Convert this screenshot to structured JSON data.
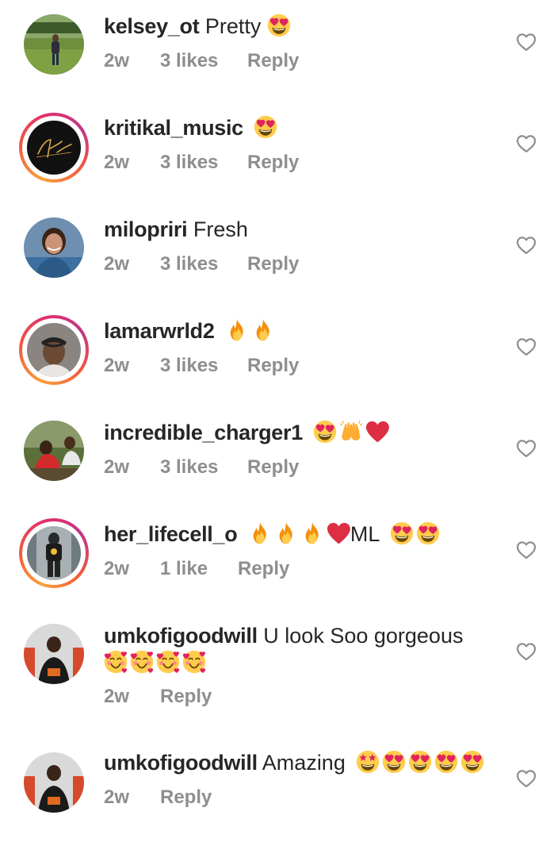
{
  "comments": [
    {
      "username": "kelsey_ot",
      "text": "Pretty",
      "emojis": [
        "heart-eyes"
      ],
      "time": "2w",
      "likes": "3 likes",
      "reply": "Reply",
      "story_ring": false
    },
    {
      "username": "kritikal_music",
      "text": "",
      "emojis": [
        "heart-eyes"
      ],
      "time": "2w",
      "likes": "3 likes",
      "reply": "Reply",
      "story_ring": true,
      "avatar_text": "Kritikal"
    },
    {
      "username": "milopriri",
      "text": "Fresh",
      "emojis": [],
      "time": "2w",
      "likes": "3 likes",
      "reply": "Reply",
      "story_ring": false
    },
    {
      "username": "lamarwrld2",
      "text": "",
      "emojis": [
        "fire",
        "fire"
      ],
      "time": "2w",
      "likes": "3 likes",
      "reply": "Reply",
      "story_ring": true
    },
    {
      "username": "incredible_charger1",
      "text": "",
      "emojis": [
        "heart-eyes",
        "raising-hands",
        "red-heart"
      ],
      "time": "2w",
      "likes": "3 likes",
      "reply": "Reply",
      "story_ring": false
    },
    {
      "username": "her_lifecell_o",
      "text_after": "ML",
      "emojis": [
        "fire",
        "fire",
        "fire",
        "red-heart"
      ],
      "emojis_after": [
        "heart-eyes",
        "heart-eyes"
      ],
      "time": "2w",
      "likes": "1 like",
      "reply": "Reply",
      "story_ring": true
    },
    {
      "username": "umkofigoodwill",
      "text": "U look Soo gorgeous",
      "emojis_line2": [
        "smiling-hearts",
        "smiling-hearts",
        "smiling-hearts",
        "smiling-hearts"
      ],
      "time": "2w",
      "reply": "Reply",
      "story_ring": false
    },
    {
      "username": "umkofigoodwill",
      "text": "Amazing",
      "emojis": [
        "star-struck",
        "heart-eyes",
        "heart-eyes",
        "heart-eyes",
        "heart-eyes"
      ],
      "time": "2w",
      "reply": "Reply",
      "story_ring": false
    }
  ],
  "icons": {
    "like": "heart-outline-icon"
  },
  "colors": {
    "text": "#262626",
    "meta": "#8e8e8e",
    "icon": "#8e8e8e"
  }
}
